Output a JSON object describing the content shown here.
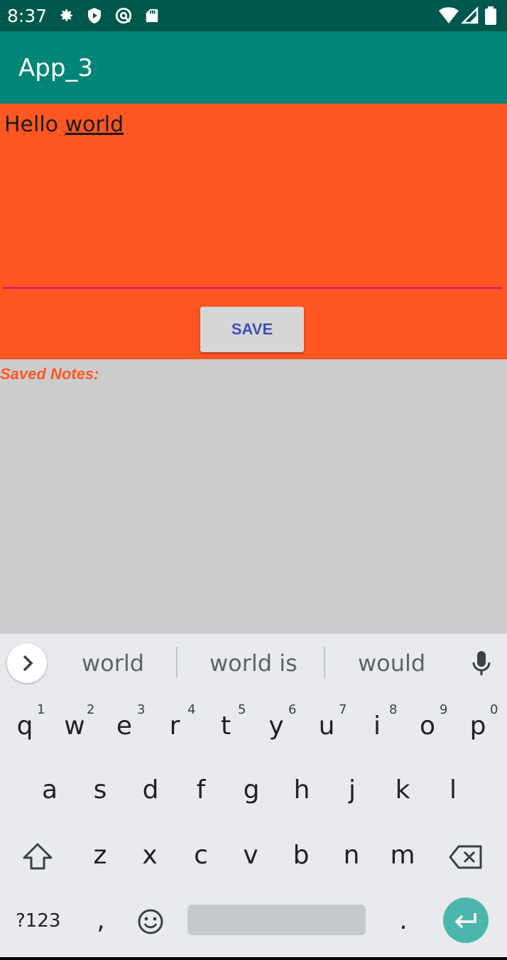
{
  "status_bar": {
    "time": "8:37",
    "left_icons": [
      "gear-icon",
      "play-protect-icon",
      "vpn-icon",
      "sd-card-icon"
    ],
    "right_icons": [
      "wifi-icon",
      "signal-icon",
      "battery-icon"
    ]
  },
  "app_bar": {
    "title": "App_3"
  },
  "editor": {
    "text_prefix": "Hello ",
    "text_word": "world",
    "accent_color": "#e91e63",
    "background_color": "#ff5722"
  },
  "save_button": {
    "label": "SAVE"
  },
  "saved_notes": {
    "title": "Saved Notes:",
    "background_color": "#cccccc"
  },
  "keyboard": {
    "suggestions": [
      "world",
      "world is",
      "would"
    ],
    "row1": [
      {
        "key": "q",
        "hint": "1"
      },
      {
        "key": "w",
        "hint": "2"
      },
      {
        "key": "e",
        "hint": "3"
      },
      {
        "key": "r",
        "hint": "4"
      },
      {
        "key": "t",
        "hint": "5"
      },
      {
        "key": "y",
        "hint": "6"
      },
      {
        "key": "u",
        "hint": "7"
      },
      {
        "key": "i",
        "hint": "8"
      },
      {
        "key": "o",
        "hint": "9"
      },
      {
        "key": "p",
        "hint": "0"
      }
    ],
    "row2": [
      "a",
      "s",
      "d",
      "f",
      "g",
      "h",
      "j",
      "k",
      "l"
    ],
    "row3": [
      "z",
      "x",
      "c",
      "v",
      "b",
      "n",
      "m"
    ],
    "symbols_label": "?123",
    "comma": ",",
    "period": ".",
    "enter_color": "#4db6ac"
  }
}
